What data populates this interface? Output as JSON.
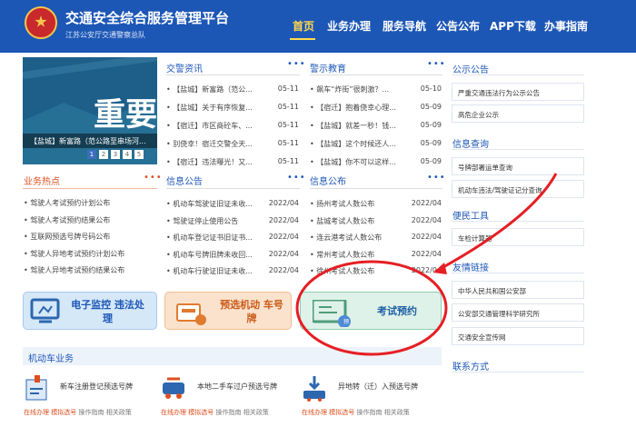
{
  "header": {
    "title": "交通安全综合服务管理平台",
    "subtitle": "江苏公安厅交通警察总队",
    "nav": [
      "首页",
      "业务办理",
      "服务导航",
      "公告公布",
      "APP下载",
      "办事指南"
    ]
  },
  "banner": {
    "big_text": "重要",
    "caption": "【盐城】新富路（范公路至串场河...",
    "pages": [
      "1",
      "2",
      "3",
      "4",
      "5"
    ]
  },
  "traffic_news": {
    "title": "交警资讯",
    "more": "•••",
    "items": [
      {
        "t": "• 【盐城】新富路（范公...",
        "d": "05-11"
      },
      {
        "t": "• 【盐城】关于有序恢复...",
        "d": "05-11"
      },
      {
        "t": "• 【宿迁】市区商砼车、...",
        "d": "05-11"
      },
      {
        "t": "• 别侥幸！宿迁交警全天...",
        "d": "05-11"
      },
      {
        "t": "• 【宿迁】违法曝光！又...",
        "d": "05-11"
      }
    ]
  },
  "warning_edu": {
    "title": "警示教育",
    "more": "•••",
    "items": [
      {
        "t": "• 飙车“炸街”很刺激？...",
        "d": "05-10"
      },
      {
        "t": "• 【宿迁】抱着侥幸心理...",
        "d": "05-09"
      },
      {
        "t": "• 【盐城】就差一秒！钱...",
        "d": "05-09"
      },
      {
        "t": "• 【盐城】这个时候还人...",
        "d": "05-09"
      },
      {
        "t": "• 【盐城】你不可以这样...",
        "d": "05-09"
      }
    ]
  },
  "hot_business": {
    "title": "业务热点",
    "more": "•••",
    "items": [
      "• 驾驶人考试预约计划公布",
      "• 驾驶人考试预约结果公布",
      "• 互联网预选号牌号码公布",
      "• 驾驶人异地考试预约计划公布",
      "• 驾驶人异地考试预约结果公布"
    ]
  },
  "info_notice": {
    "title": "信息公告",
    "more": "•••",
    "items": [
      {
        "t": "• 机动车驾驶证旧证未收...",
        "d": "2022/04"
      },
      {
        "t": "• 驾驶证停止使用公告",
        "d": "2022/04"
      },
      {
        "t": "• 机动车登记证书旧证书...",
        "d": "2022/04"
      },
      {
        "t": "• 机动车号牌旧牌未收回...",
        "d": "2022/04"
      },
      {
        "t": "• 机动车行驶证旧证未收...",
        "d": "2022/04"
      }
    ]
  },
  "info_public": {
    "title": "信息公布",
    "more": "•••",
    "items": [
      {
        "t": "• 扬州考试人数公布",
        "d": "2022/04"
      },
      {
        "t": "• 盐城考试人数公布",
        "d": "2022/04"
      },
      {
        "t": "• 连云港考试人数公布",
        "d": "2022/04"
      },
      {
        "t": "• 常州考试人数公布",
        "d": "2022/04"
      },
      {
        "t": "• 徐州考试人数公布",
        "d": "2022/04"
      }
    ]
  },
  "tiles": {
    "monitor": "电子监控 违法处理",
    "preselect": "预选机动 车号牌",
    "exam": "考试预约",
    "exam_badge": "预"
  },
  "vehicle": {
    "title": "机动车业务",
    "services": [
      {
        "title": "新车注册登记预选号牌",
        "a": "在线办理",
        "b": "模拟选号",
        "c": "操作指南",
        "d": "相关政策"
      },
      {
        "title": "本地二手车过户预选号牌",
        "a": "在线办理",
        "b": "模拟选号",
        "c": "操作指南",
        "d": "相关政策"
      },
      {
        "title": "异地转（迁）入预选号牌",
        "a": "在线办理",
        "b": "模拟选号",
        "c": "操作指南",
        "d": "相关政策"
      }
    ]
  },
  "right": {
    "notice_title": "公示公告",
    "notice": [
      "严重交通违法行为公示公告",
      "高危企业公示"
    ],
    "query_title": "信息查询",
    "query": [
      "号牌部署运单查询",
      "机动车违法/驾驶证记分查询"
    ],
    "tools_title": "便民工具",
    "tools": [
      "车检计算器"
    ],
    "links_title": "友情链接",
    "links": [
      "中华人民共和国公安部",
      "公安部交通管理科学研究所",
      "交通安全宣传网"
    ],
    "contact_title": "联系方式"
  },
  "colors": {
    "header": "#1d57b6",
    "accent": "#de4f1e",
    "annotation": "#e51f24"
  }
}
